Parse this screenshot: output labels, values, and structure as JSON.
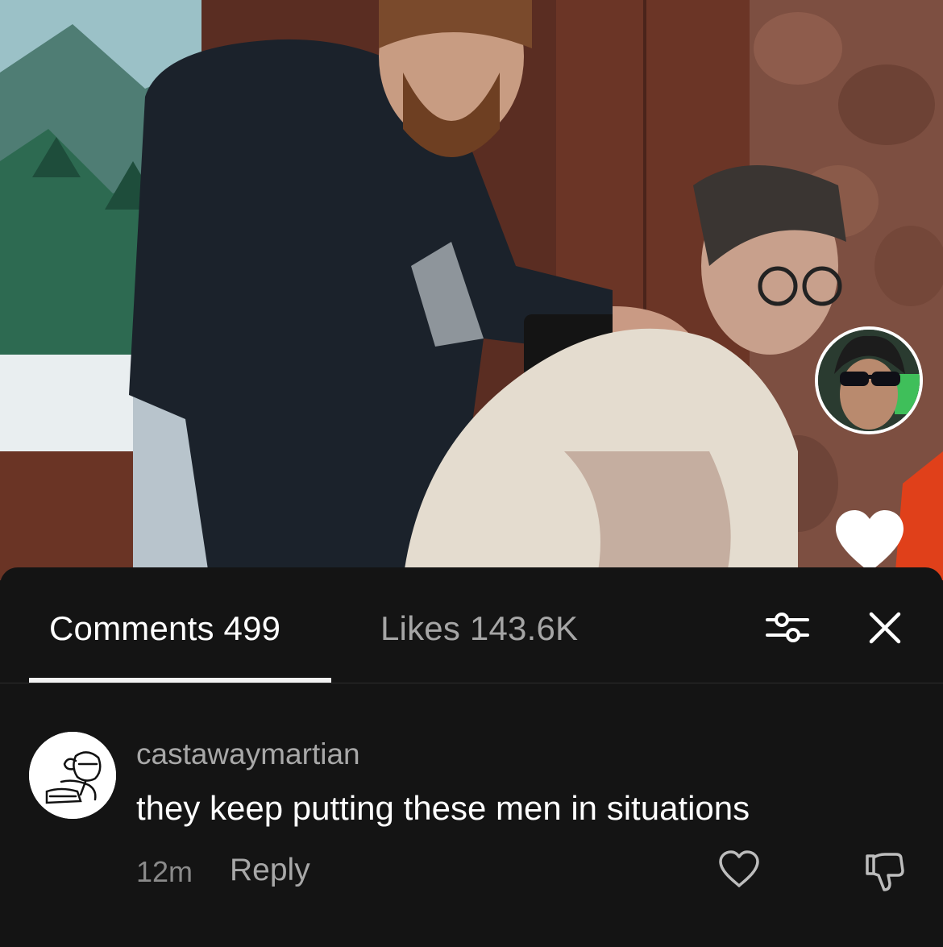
{
  "video": {
    "creator_avatar_icon": "creator-profile-avatar",
    "like_icon": "heart-icon"
  },
  "comments_panel": {
    "tabs": [
      {
        "label": "Comments 499",
        "active": true
      },
      {
        "label": "Likes 143.6K",
        "active": false
      }
    ],
    "filter_icon": "sliders-icon",
    "close_icon": "close-icon"
  },
  "comments": [
    {
      "username": "castawaymartian",
      "text": "they keep putting these men in situations",
      "time": "12m",
      "reply_label": "Reply",
      "like_icon": "heart-outline-icon",
      "dislike_icon": "thumbs-down-icon"
    }
  ],
  "colors": {
    "background": "#141414",
    "active_tab": "#ffffff",
    "inactive_tab": "#a6a6a6",
    "secondary_text": "#a8a8a8"
  }
}
